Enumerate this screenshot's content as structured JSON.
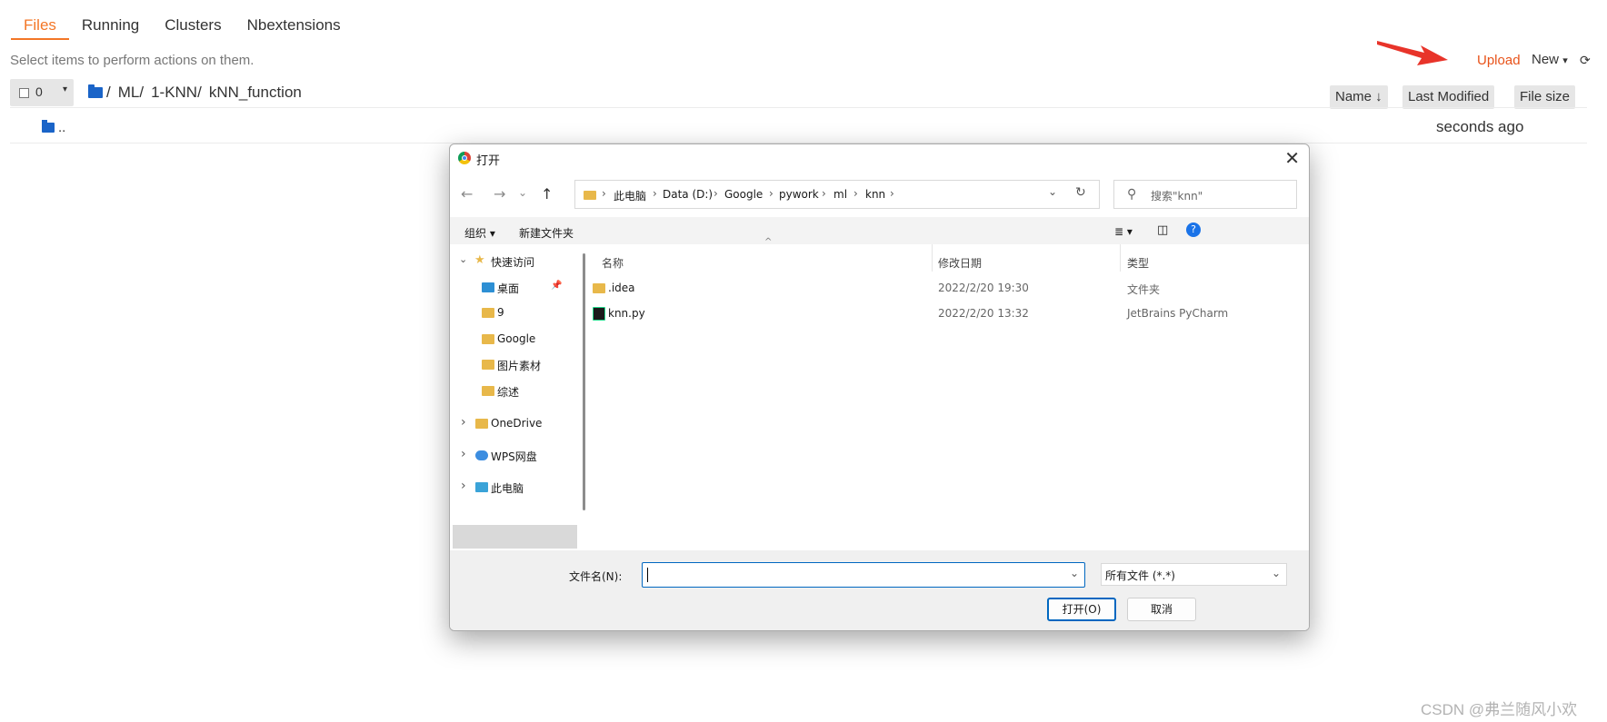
{
  "tabs": [
    {
      "label": "Files",
      "active": true
    },
    {
      "label": "Running"
    },
    {
      "label": "Clusters"
    },
    {
      "label": "Nbextensions"
    }
  ],
  "hint": "Select items to perform actions on them.",
  "toolbar": {
    "upload": "Upload",
    "new": "New",
    "new_caret": "▾",
    "refresh": "⟳"
  },
  "selection": {
    "count": "0",
    "caret": "▾"
  },
  "breadcrumb": [
    "/",
    "ML/",
    "1-KNN/",
    "kNN_function"
  ],
  "sort_buttons": {
    "name": "Name ↓",
    "last_modified": "Last Modified",
    "file_size": "File size"
  },
  "up_row": {
    "label": "..",
    "time": "seconds ago"
  },
  "dialog": {
    "title": "打开",
    "close": "✕",
    "nav": {
      "back": "←",
      "forward": "→",
      "recent": "⌄",
      "up": "↑",
      "refresh": "↻",
      "dropdown": "⌄"
    },
    "address": [
      "此电脑",
      "Data (D:)",
      "Google",
      "pywork",
      "ml",
      "knn"
    ],
    "address_sep": "›",
    "search_placeholder": "搜索\"knn\"",
    "commands": {
      "organize": "组织 ▾",
      "new_folder": "新建文件夹",
      "view": "≣ ▾",
      "pane": "◫",
      "help": "?"
    },
    "nav_pane": {
      "quick_access": "快速访问",
      "items": [
        "桌面",
        "9",
        "Google",
        "图片素材",
        "综述"
      ],
      "onedrive": "OneDrive",
      "wps": "WPS网盘",
      "this_pc": "此电脑",
      "pin": "📌",
      "chev_open": "⌄",
      "chev_closed": "›"
    },
    "columns": {
      "name": "名称",
      "date": "修改日期",
      "type": "类型",
      "sort_caret": "^"
    },
    "files": [
      {
        "name": ".idea",
        "date": "2022/2/20 19:30",
        "type": "文件夹",
        "icon": "folder-icon"
      },
      {
        "name": "knn.py",
        "date": "2022/2/20 13:32",
        "type": "JetBrains PyCharm",
        "icon": "pycharm-file-icon"
      }
    ],
    "filename_label": "文件名(N):",
    "filename_value": "",
    "filetype": "所有文件 (*.*)",
    "open_button": "打开(O)",
    "cancel_button": "取消"
  },
  "watermark": "CSDN @弗兰随风小欢",
  "colors": {
    "accent": "#f37626",
    "upload": "#e8531a",
    "folder_blue": "#1a64c8",
    "folder_yellow": "#e8b84a",
    "win_accent": "#0067c0"
  }
}
